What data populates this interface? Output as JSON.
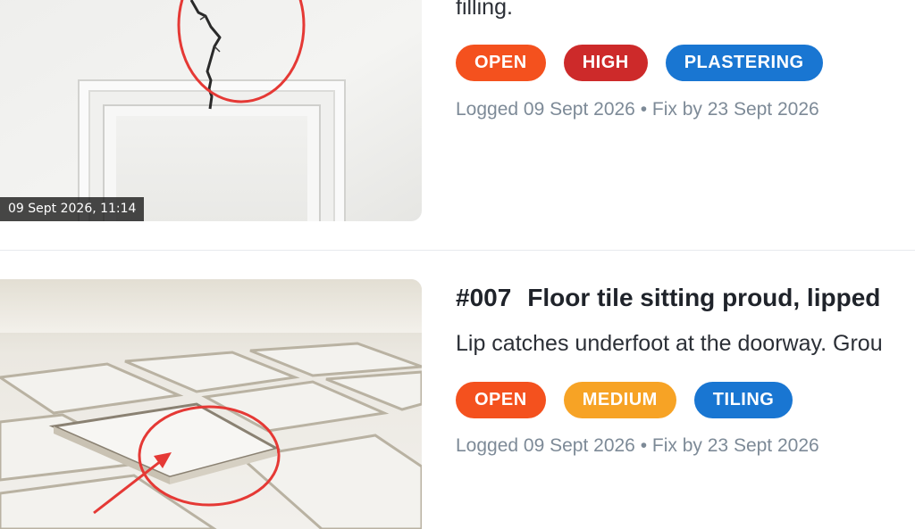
{
  "colors": {
    "open": "#f4511e",
    "high": "#cd2a2a",
    "medium": "#f7a325",
    "trade": "#1976d2",
    "annotation": "#e53935"
  },
  "issues": [
    {
      "description": "filling.",
      "timestamp": "09 Sept 2026, 11:14",
      "badges": {
        "status": "OPEN",
        "priority": "HIGH",
        "trade": "PLASTERING"
      },
      "logged": "Logged 09 Sept 2026",
      "separator": "•",
      "fix_by": "Fix by 23 Sept 2026"
    },
    {
      "number": "#007",
      "title": "Floor tile sitting proud, lipped",
      "description": "Lip catches underfoot at the doorway. Grou",
      "badges": {
        "status": "OPEN",
        "priority": "MEDIUM",
        "trade": "TILING"
      },
      "logged": "Logged 09 Sept 2026",
      "separator": "•",
      "fix_by": "Fix by 23 Sept 2026"
    }
  ]
}
